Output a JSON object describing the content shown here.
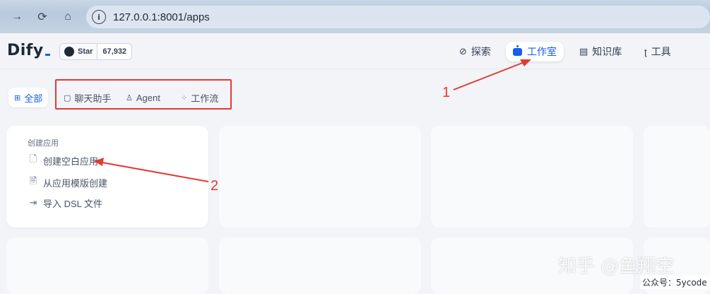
{
  "browser": {
    "back_icon": "arrow-right-icon",
    "reload_icon": "reload-icon",
    "home_icon": "home-icon",
    "url": "127.0.0.1:8001/apps"
  },
  "header": {
    "logo": "Dify",
    "github": {
      "star_label": "Star",
      "star_count": "67,932"
    },
    "nav": [
      {
        "label": "探索",
        "icon": "compass-icon"
      },
      {
        "label": "工作室",
        "icon": "robot-icon",
        "active": true
      },
      {
        "label": "知识库",
        "icon": "book-icon"
      },
      {
        "label": "工具",
        "icon": "tool-icon"
      }
    ]
  },
  "tabs": [
    {
      "label": "全部",
      "icon": "grid-icon",
      "active": true
    },
    {
      "label": "聊天助手",
      "icon": "chat-icon"
    },
    {
      "label": "Agent",
      "icon": "agent-icon"
    },
    {
      "label": "工作流",
      "icon": "workflow-icon"
    }
  ],
  "create_card": {
    "title": "创建应用",
    "items": [
      {
        "label": "创建空白应用",
        "icon": "file-plus-icon"
      },
      {
        "label": "从应用模版创建",
        "icon": "file-template-icon"
      },
      {
        "label": "导入 DSL 文件",
        "icon": "import-icon"
      }
    ]
  },
  "annotations": {
    "one": "1",
    "two": "2"
  },
  "watermark": {
    "main": "知乎 @鱼翔空",
    "sub": "公众号：5ycode"
  },
  "colors": {
    "accent": "#155eef",
    "annotation": "#e53935"
  }
}
